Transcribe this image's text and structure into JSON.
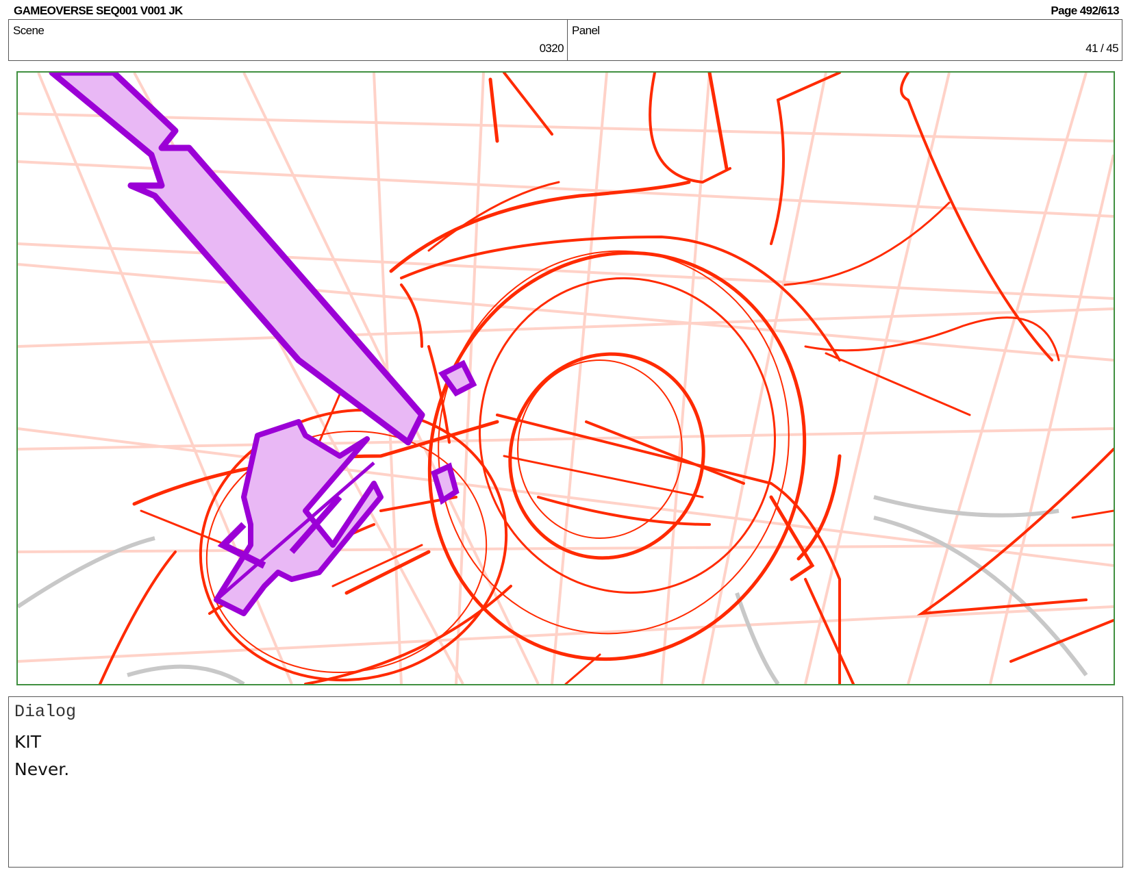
{
  "header": {
    "title": "GAMEOVERSE SEQ001 V001 JK",
    "page": "Page 492/613"
  },
  "scene": {
    "label": "Scene",
    "value": "0320"
  },
  "panel": {
    "label": "Panel",
    "value": "41 / 45"
  },
  "frame": {
    "colors": {
      "border": "#3f8f3f",
      "sketch": "#ff2a00",
      "bolt_stroke": "#9b00d6",
      "bolt_fill": "#e9b8f5",
      "grid": "#ffd2c8",
      "gray": "#c8c8c8"
    }
  },
  "dialog": {
    "label": "Dialog",
    "character": "KIT",
    "line": "Never."
  }
}
